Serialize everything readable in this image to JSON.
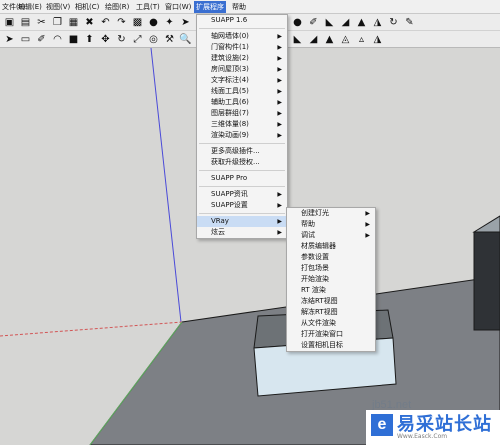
{
  "menubar": {
    "items": [
      "文件(F)",
      "编辑(E)",
      "视图(V)",
      "相机(C)",
      "绘图(R)",
      "工具(T)",
      "窗口(W)",
      "扩展程序",
      "帮助"
    ],
    "active_index": 7
  },
  "toolbar1": {
    "icons": [
      "open-icon",
      "save-icon",
      "cut-icon",
      "copy-icon",
      "paste-icon",
      "delete-icon",
      "undo-icon",
      "redo-icon",
      "print-icon",
      "info-icon",
      "light-icon",
      "arrow-icon",
      "shape-icon",
      "shape-icon",
      "wrench-icon",
      "pencil-tool-icon",
      "edge-tool-icon",
      "shape-icon",
      "sphere-icon",
      "pencil-tool-icon",
      "shape-icon",
      "shape-icon",
      "shape-icon",
      "shape-icon",
      "rotate-icon",
      "pencil-tool-icon"
    ],
    "glyphs": [
      "▣",
      "▤",
      "✂",
      "❐",
      "▦",
      "✖",
      "↶",
      "↷",
      "▩",
      "●",
      "✦",
      "➤",
      "◆",
      "■",
      "⚒",
      "✎",
      "↗",
      "◒",
      "●",
      "✐",
      "◣",
      "◢",
      "▲",
      "◮",
      "↻",
      "✎"
    ]
  },
  "toolbar2": {
    "icons": [
      "select-icon",
      "eraser-icon",
      "pencil-icon",
      "arc-icon",
      "rectangle-icon",
      "push-pull-icon",
      "move-icon",
      "rotate-icon",
      "scale-icon",
      "offset-icon",
      "tape-measure-icon",
      "zoom-icon",
      "zoom-extents-icon",
      "render-icon",
      "cube-icon",
      "sphere-icon",
      "shape-icon",
      "shape-icon",
      "shape-icon",
      "shape-icon",
      "shape-icon",
      "shape-icon",
      "shape-icon",
      "shape-icon"
    ],
    "glyphs": [
      "➤",
      "▭",
      "✐",
      "◠",
      "■",
      "⬆",
      "✥",
      "↻",
      "⤢",
      "◎",
      "⚒",
      "🔍",
      "⊠",
      "◈",
      "▣",
      "●",
      "✦",
      "✕",
      "◣",
      "◢",
      "▲",
      "◬",
      "▵",
      "◮"
    ]
  },
  "extensions_menu": {
    "items": [
      {
        "label": "SUAPP 1.6",
        "submenu": false
      },
      {
        "separator": true
      },
      {
        "label": "轴网墙体(0)",
        "submenu": true
      },
      {
        "label": "门窗构件(1)",
        "submenu": true
      },
      {
        "label": "建筑设施(2)",
        "submenu": true
      },
      {
        "label": "房间屋顶(3)",
        "submenu": true
      },
      {
        "label": "文字标注(4)",
        "submenu": true
      },
      {
        "label": "线面工具(5)",
        "submenu": true
      },
      {
        "label": "辅助工具(6)",
        "submenu": true
      },
      {
        "label": "图层群组(7)",
        "submenu": true
      },
      {
        "label": "三维体量(8)",
        "submenu": true
      },
      {
        "label": "渲染动画(9)",
        "submenu": true
      },
      {
        "separator": true
      },
      {
        "label": "更多高级插件...",
        "submenu": false
      },
      {
        "label": "获取升级授权...",
        "submenu": false
      },
      {
        "separator": true
      },
      {
        "label": "SUAPP Pro",
        "submenu": false
      },
      {
        "separator": true
      },
      {
        "label": "SUAPP资讯",
        "submenu": true
      },
      {
        "label": "SUAPP设置",
        "submenu": true
      },
      {
        "separator": true
      },
      {
        "label": "VRay",
        "submenu": true,
        "highlighted": true
      },
      {
        "label": "炫云",
        "submenu": true
      }
    ]
  },
  "vray_submenu": {
    "items": [
      {
        "label": "创建灯光",
        "submenu": true
      },
      {
        "label": "帮助",
        "submenu": true
      },
      {
        "label": "调试",
        "submenu": true
      },
      {
        "label": "材质编辑器",
        "submenu": false
      },
      {
        "label": "参数设置",
        "submenu": false
      },
      {
        "label": "打包场景",
        "submenu": false
      },
      {
        "label": "开始渲染",
        "submenu": false
      },
      {
        "label": "RT 渲染",
        "submenu": false
      },
      {
        "label": "冻结RT视图",
        "submenu": false
      },
      {
        "label": "解冻RT视图",
        "submenu": false
      },
      {
        "label": "从文件渲染",
        "submenu": false
      },
      {
        "label": "打开渲染窗口",
        "submenu": false
      },
      {
        "label": "设置相机目标",
        "submenu": false
      }
    ]
  },
  "watermark": {
    "url": "jb51.net",
    "logo_glyph": "e",
    "name": "易采站长站",
    "subtitle": "Www.Easck.Com"
  },
  "colors": {
    "menu_highlight": "#c9dcf4",
    "active_menu": "#3a6fd1",
    "ground": "#7d8085",
    "box_light": "#d7e6ef",
    "watermark_blue": "#2f6fd6"
  }
}
